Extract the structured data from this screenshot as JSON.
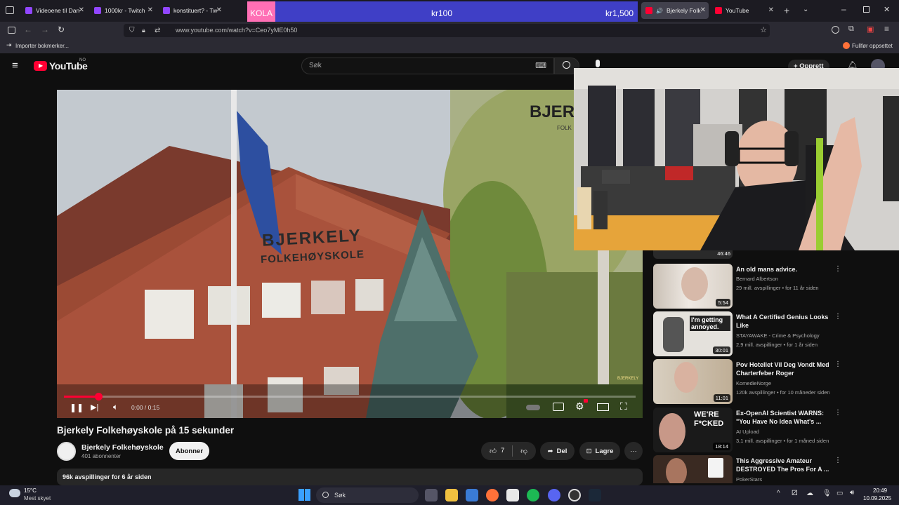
{
  "browser": {
    "tabs": [
      {
        "label": "Videoene til Dan",
        "color": "#9146ff"
      },
      {
        "label": "1000kr - Twitch",
        "color": "#9146ff"
      },
      {
        "label": "konstituert? - Tw",
        "color": "#9146ff"
      },
      {
        "label": "Bjerkely Folk",
        "color": "#ff0033"
      },
      {
        "label": "YouTube",
        "color": "#ff0033"
      }
    ],
    "url": "www.youtube.com/watch?v=Ceo7yME0h50",
    "bookmarks_import": "Importer bokmerker...",
    "finish_setup": "Fullfør oppsettet"
  },
  "donation": {
    "name": "KOLA",
    "amount": "kr100",
    "goal": "kr1,500"
  },
  "youtube": {
    "logo": "YouTube",
    "region": "NO",
    "search_placeholder": "Søk",
    "create_label": "Opprett"
  },
  "video": {
    "sign_text_1": "BJERKELY",
    "sign_text_2": "FOLKEHØYSKOLE",
    "corner_brand": "BJERKELY",
    "corner_sub": "FOLK",
    "time": "0:00 / 0:15",
    "progress": 0.06,
    "title": "Bjerkely Folkehøyskole på 15 sekunder",
    "channel": "Bjerkely Folkehøyskole",
    "subscribers": "401 abonnenter",
    "subscribe_label": "Abonner",
    "likes": "7",
    "share_label": "Del",
    "save_label": "Lagre",
    "views_line": "96k avspillinger  for 6 år siden"
  },
  "sidebar": {
    "partial_duration": "46:46",
    "items": [
      {
        "title": "An old mans advice.",
        "channel": "Bernard Albertson",
        "meta": "29 mill. avspillinger • for 11 år siden",
        "duration": "5:54"
      },
      {
        "title": "What A Certified Genius Looks Like",
        "channel": "STAYAWAKE - Crime & Psychology",
        "meta": "2,9 mill. avspillinger • for 1 år siden",
        "duration": "30:01",
        "thumb_text": "I'm getting annoyed."
      },
      {
        "title": "Pov Hotellet Vil Deg Vondt Med Charterfeber Roger",
        "channel": "KomedieNorge",
        "meta": "120k avspillinger • for 10 måneder siden",
        "duration": "11:01"
      },
      {
        "title": "Ex-OpenAI Scientist WARNS: \"You Have No Idea What's ...",
        "channel": "AI Upload",
        "meta": "3,1 mill. avspillinger • for 1 måned siden",
        "duration": "18:14",
        "thumb_text": "WE'RE F*CKED"
      },
      {
        "title": "This Aggressive Amateur DESTROYED The Pros For A ...",
        "channel": "PokerStars",
        "meta": "",
        "duration": ""
      }
    ]
  },
  "taskbar": {
    "weather_temp": "15°C",
    "weather_desc": "Mest skyet",
    "search_label": "Søk",
    "time": "20:49",
    "date": "10.09.2025"
  }
}
